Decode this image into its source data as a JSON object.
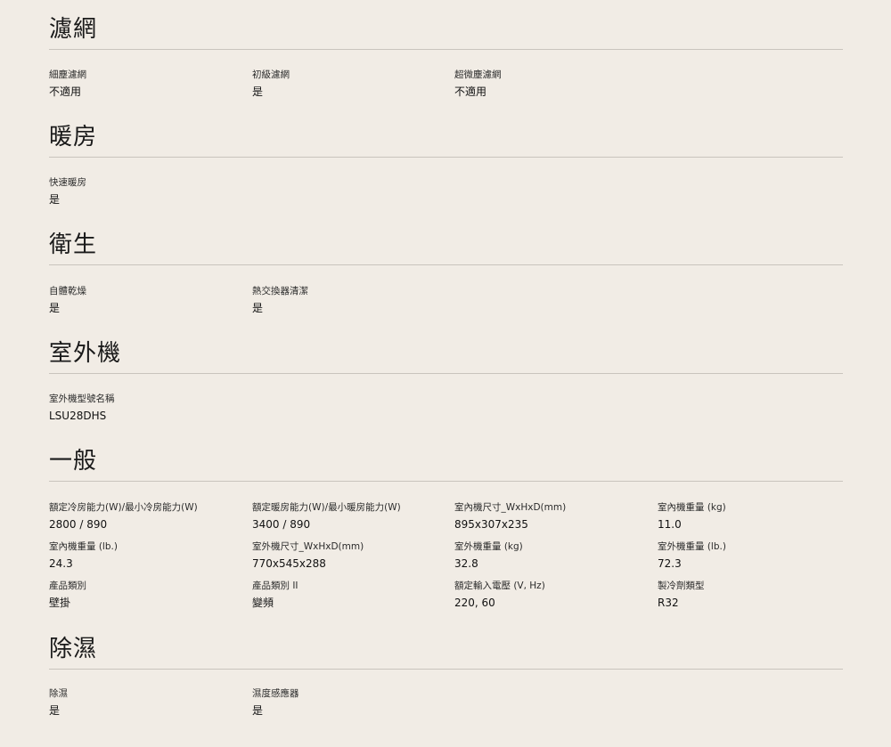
{
  "sections": [
    {
      "title": "濾網",
      "items": [
        {
          "label": "細塵濾網",
          "value": "不適用"
        },
        {
          "label": "初級濾網",
          "value": "是"
        },
        {
          "label": "超微塵濾網",
          "value": "不適用"
        }
      ]
    },
    {
      "title": "暖房",
      "items": [
        {
          "label": "快速暖房",
          "value": "是"
        }
      ]
    },
    {
      "title": "衛生",
      "items": [
        {
          "label": "自體乾燥",
          "value": "是"
        },
        {
          "label": "熱交換器清潔",
          "value": "是"
        }
      ]
    },
    {
      "title": "室外機",
      "items": [
        {
          "label": "室外機型號名稱",
          "value": "LSU28DHS"
        }
      ]
    },
    {
      "title": "一般",
      "items": [
        {
          "label": "額定冷房能力(W)/最小冷房能力(W)",
          "value": "2800 / 890"
        },
        {
          "label": "額定暖房能力(W)/最小暖房能力(W)",
          "value": "3400 / 890"
        },
        {
          "label": "室內機尺寸_WxHxD(mm)",
          "value": "895x307x235"
        },
        {
          "label": "室內機重量 (kg)",
          "value": "11.0"
        },
        {
          "label": "室內機重量 (lb.)",
          "value": "24.3"
        },
        {
          "label": "室外機尺寸_WxHxD(mm)",
          "value": "770x545x288"
        },
        {
          "label": "室外機重量 (kg)",
          "value": "32.8"
        },
        {
          "label": "室外機重量 (lb.)",
          "value": "72.3"
        },
        {
          "label": "產品類別",
          "value": "壁掛"
        },
        {
          "label": "產品類別 II",
          "value": "變頻"
        },
        {
          "label": "額定輸入電壓 (V, Hz)",
          "value": "220, 60"
        },
        {
          "label": "製冷劑類型",
          "value": "R32"
        }
      ]
    },
    {
      "title": "除濕",
      "items": [
        {
          "label": "除濕",
          "value": "是"
        },
        {
          "label": "濕度感應器",
          "value": "是"
        }
      ]
    }
  ]
}
